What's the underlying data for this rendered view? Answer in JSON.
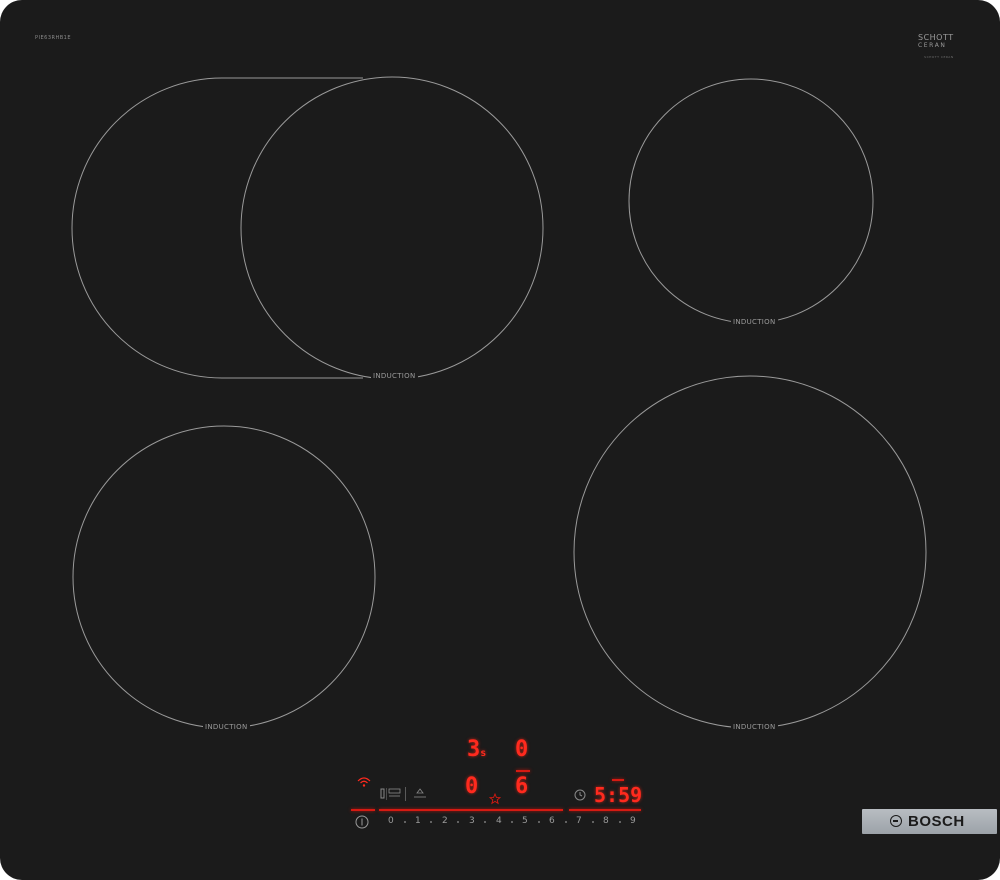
{
  "hob": {
    "model_code": "PIE63RHB1E",
    "schott": {
      "line1": "SCHOTT",
      "line2": "CERAN",
      "line3": "SCHOTT CERAN"
    },
    "zones": [
      {
        "id": "front-left-flex",
        "label": "INDUCTION"
      },
      {
        "id": "back-right",
        "label": "INDUCTION"
      },
      {
        "id": "back-left",
        "label": "INDUCTION"
      },
      {
        "id": "front-right",
        "label": "INDUCTION"
      }
    ]
  },
  "controls": {
    "display_top_left": "3",
    "display_top_left_sub": "s",
    "display_top_right": "0",
    "display_bottom_left": "0",
    "display_bottom_right": "6",
    "timer": {
      "value": "5:59"
    },
    "power_scale": [
      "0",
      "1",
      "2",
      "3",
      "4",
      "5",
      "6",
      "7",
      "8",
      "9"
    ],
    "icons": [
      "wifi-icon",
      "frying-sensor-icon",
      "boost-icon",
      "favourite-star-icon",
      "clock-icon",
      "power-icon"
    ],
    "colors": {
      "display": "#ff2a1e",
      "glass": "#1b1b1b",
      "line": "#d61a12"
    }
  },
  "brand": {
    "name": "BOSCH"
  }
}
